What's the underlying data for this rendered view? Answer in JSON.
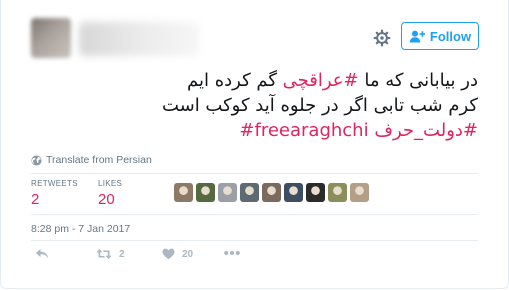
{
  "header": {
    "follow_label": "Follow"
  },
  "tweet": {
    "line1": {
      "before": "در بیابانی که ما ",
      "hashtag": "#عراقچی",
      "after": " گم کرده ایم"
    },
    "line2": "کرم شب تابی اگر در جلوه آید کوکب است",
    "line3": {
      "hashtag1": "#دولت_حرف",
      "hashtag2": "#freearaghchi"
    }
  },
  "translate_label": "Translate from Persian",
  "stats": {
    "retweets_label": "RETWEETS",
    "retweets_value": "2",
    "likes_label": "LIKES",
    "likes_value": "20"
  },
  "liker_avatar_colors": [
    "#8d7a66",
    "#556b3f",
    "#9aa0a6",
    "#5d6a72",
    "#7b6a5e",
    "#3d4e63",
    "#2b2b2b",
    "#8a8f5a",
    "#b59e86"
  ],
  "timestamp": "8:28 pm - 7 Jan 2017",
  "actions": {
    "retweet_count": "2",
    "like_count": "20"
  },
  "colors": {
    "accent": "#1da1f2",
    "hashtag": "#e0245e",
    "muted": "#657786",
    "icon": "#aab8c2"
  },
  "icons": [
    "settings-gear-icon",
    "follow-user-plus-icon",
    "globe-icon",
    "reply-icon",
    "retweet-icon",
    "heart-icon",
    "more-icon"
  ]
}
